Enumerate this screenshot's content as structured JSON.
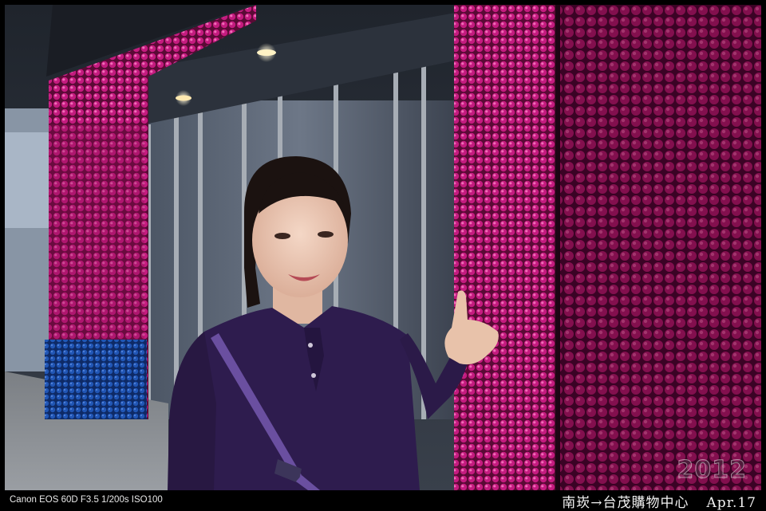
{
  "photo": {
    "year_watermark": "2012",
    "exif": "Canon EOS 60D  F3.5 1/200s ISO100",
    "location_caption": "南崁→台茂購物中心",
    "date_caption": "Apr.17"
  },
  "colors": {
    "sequin_pink": "#d3208a",
    "sequin_blue": "#1c4aa0",
    "sweater_purple": "#2e1c4e",
    "strap_lavender": "#6a4fa0",
    "border": "#000000"
  }
}
